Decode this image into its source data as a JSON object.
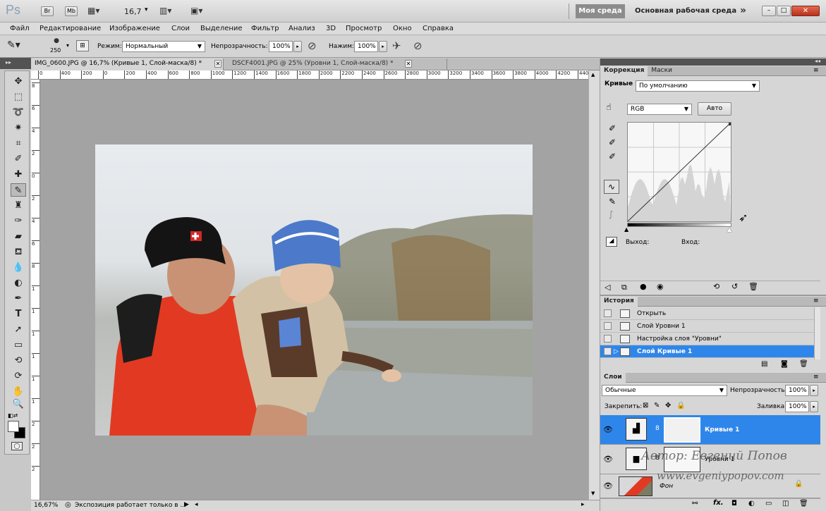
{
  "app": {
    "logo": "Ps",
    "buttons": [
      "Br",
      "Mb"
    ],
    "zoom": "16,7",
    "workspace_active": "Моя среда",
    "workspace_main": "Основная рабочая среда",
    "more": "»",
    "window_controls": [
      "–",
      "□",
      "✕"
    ]
  },
  "menu": [
    "Файл",
    "Редактирование",
    "Изображение",
    "Слои",
    "Выделение",
    "Фильтр",
    "Анализ",
    "3D",
    "Просмотр",
    "Окно",
    "Справка"
  ],
  "options": {
    "brush_size": "250",
    "mode_label": "Режим:",
    "mode_value": "Нормальный",
    "opacity_label": "Непрозрачность:",
    "opacity_value": "100%",
    "flow_label": "Нажим:",
    "flow_value": "100%"
  },
  "tabs": [
    {
      "label": "IMG_0600.JPG @ 16,7% (Кривые 1, Слой-маска/8) *",
      "close": "✕"
    },
    {
      "label": "DSCF4001.JPG @ 25% (Уровни 1, Слой-маска/8) *",
      "close": "✕"
    }
  ],
  "ruler": {
    "h_ticks": [
      "0",
      "400",
      "200",
      "0",
      "200",
      "400",
      "600",
      "800",
      "1000",
      "1200",
      "1400",
      "1600",
      "1800",
      "2000",
      "2200",
      "2400",
      "2600",
      "2800",
      "3000",
      "3200",
      "3400",
      "3600",
      "3800",
      "4000",
      "4200",
      "4400"
    ],
    "v_ticks": [
      "8",
      "6",
      "4",
      "2",
      "0",
      "2",
      "4",
      "6",
      "8",
      "1",
      "1",
      "1",
      "1",
      "1",
      "1",
      "2",
      "2",
      "2"
    ]
  },
  "status": {
    "zoom": "16,67%",
    "message": "Экспозиция работает только в ..."
  },
  "adjustments": {
    "tabs": [
      "Коррекция",
      "Маски"
    ],
    "preset_label": "Кривые",
    "preset_value": "По умолчанию",
    "channel": "RGB",
    "auto_button": "Авто",
    "output_label": "Выход:",
    "input_label": "Вход:"
  },
  "history": {
    "tab": "История",
    "items": [
      "Открыть",
      "Слой Уровни 1",
      "Настройка слоя \"Уровни\"",
      "Слой Кривые 1"
    ],
    "selected_index": 3
  },
  "layers": {
    "tab": "Слои",
    "blend_mode": "Обычные",
    "opacity_label": "Непрозрачность:",
    "opacity_value": "100%",
    "lock_label": "Закрепить:",
    "fill_label": "Заливка:",
    "fill_value": "100%",
    "items": [
      "Кривые 1",
      "Уровни 1",
      "Фон"
    ],
    "selected_index": 0
  },
  "watermark": {
    "author": "Автор: Евгений Попов",
    "site": "www.evgeniypopov.com"
  },
  "colors": {
    "accent": "#3d8ee8",
    "selection": "#2f86ea",
    "canvas_bg": "#a3a3a3",
    "jacket": "#e23a22"
  }
}
